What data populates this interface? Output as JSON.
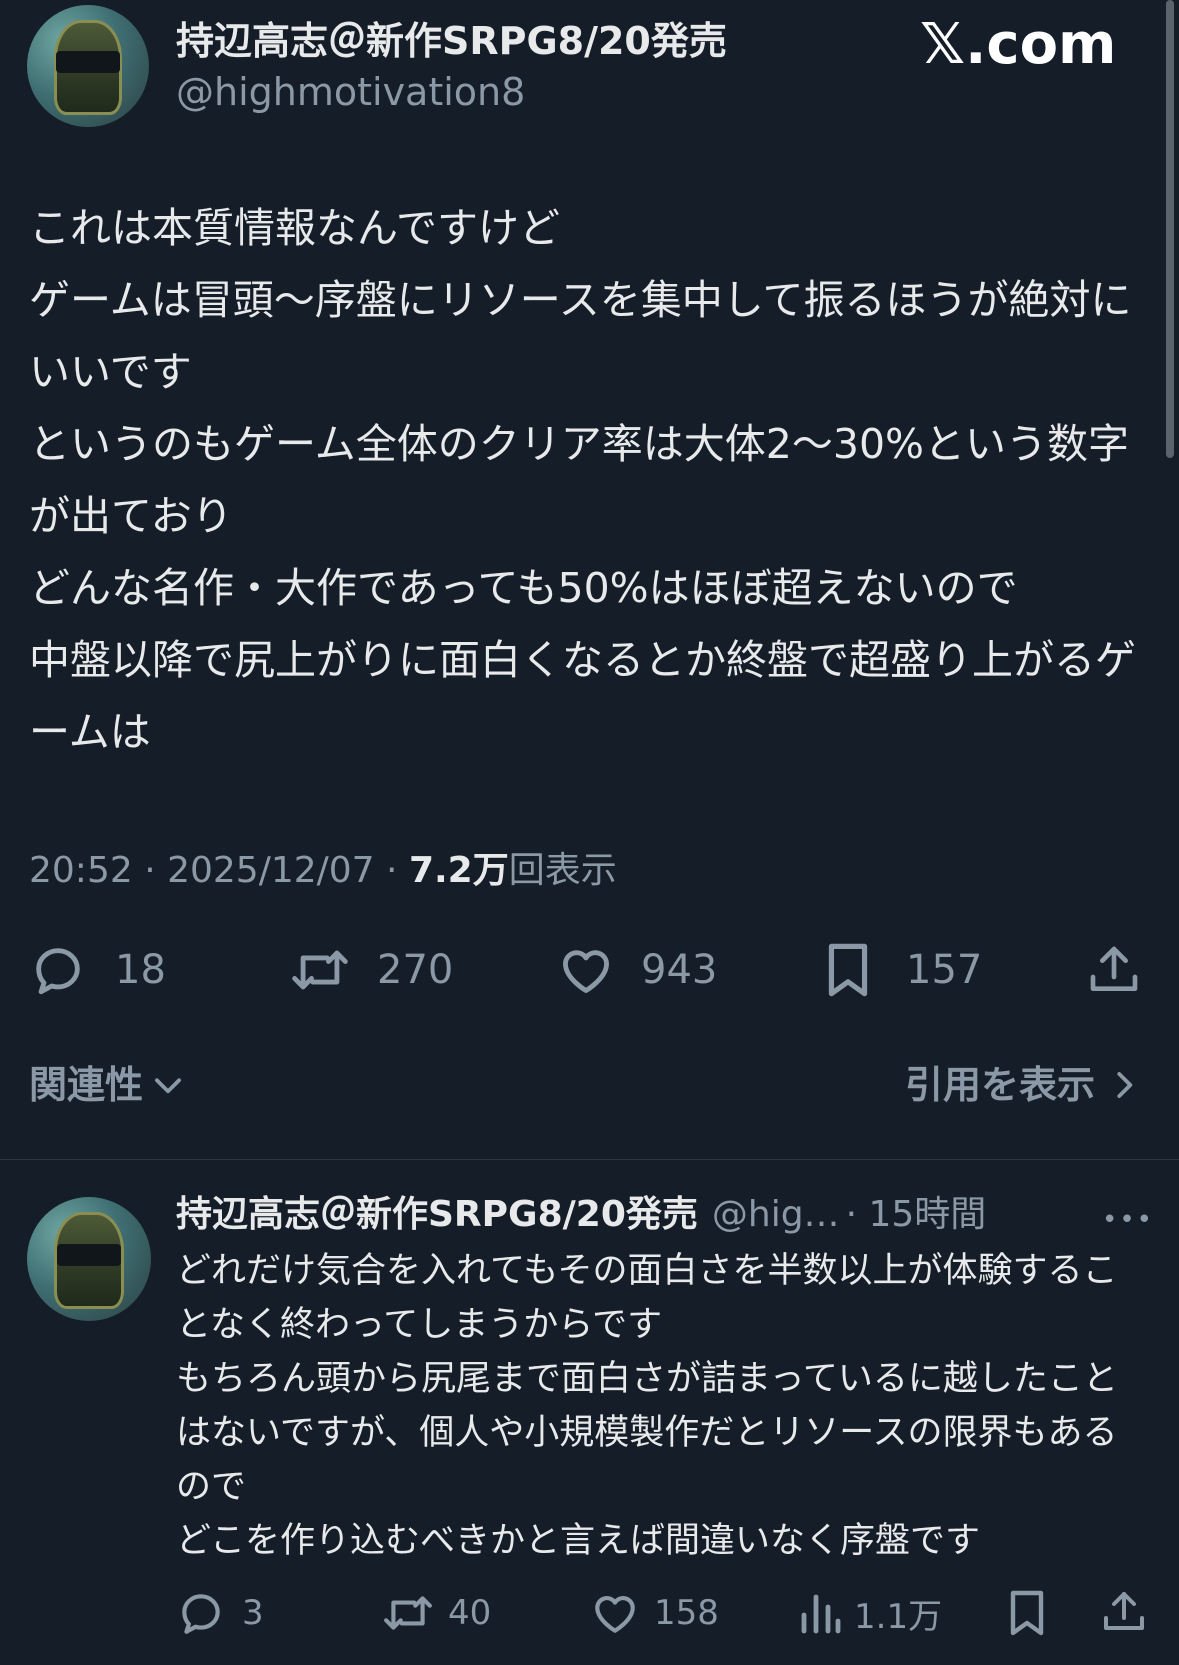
{
  "brand": "𝕏.com",
  "main_tweet": {
    "author_name": "持辺高志＠新作SRPG8/20発売",
    "author_handle": "@highmotivation8",
    "text": "これは本質情報なんですけど\nゲームは冒頭〜序盤にリソースを集中して振るほうが絶対にいいです\nというのもゲーム全体のクリア率は大体2〜30%という数字が出ており\nどんな名作・大作であっても50%はほぼ超えないので\n中盤以降で尻上がりに面白くなるとか終盤で超盛り上がるゲームは",
    "time": "20:52",
    "date": "2025/12/07",
    "views_count": "7.2万",
    "views_label": "回表示",
    "replies": "18",
    "reposts": "270",
    "likes": "943",
    "bookmarks": "157"
  },
  "sort_label": "関連性",
  "quotes_label": "引用を表示",
  "reply_tweet": {
    "author_name": "持辺高志＠新作SRPG8/20発売",
    "author_handle": "@hig…",
    "time_ago": "· 15時間",
    "more": "•••",
    "text": "どれだけ気合を入れてもその面白さを半数以上が体験することなく終わってしまうからです\nもちろん頭から尻尾まで面白さが詰まっているに越したことはないですが、個人や小規模製作だとリソースの限界もあるので\nどこを作り込むべきかと言えば間違いなく序盤です",
    "replies": "3",
    "reposts": "40",
    "likes": "158",
    "views": "1.1万"
  },
  "colors": {
    "background": "#151d28",
    "text": "#e7e9ea",
    "muted": "#8b98a5",
    "divider": "#2f3640"
  },
  "icons": [
    "reply-icon",
    "repost-icon",
    "like-icon",
    "bookmark-icon",
    "share-icon",
    "views-icon",
    "chevron-down-icon",
    "chevron-right-icon",
    "more-icon"
  ]
}
